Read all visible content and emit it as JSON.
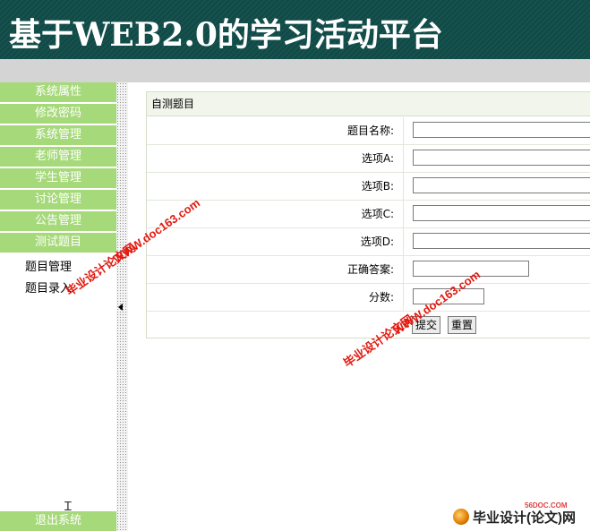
{
  "header": {
    "title": "基于WEB2.0的学习活动平台"
  },
  "sidebar": {
    "items": [
      {
        "label": "系统属性"
      },
      {
        "label": "修改密码"
      },
      {
        "label": "系统管理"
      },
      {
        "label": "老师管理"
      },
      {
        "label": "学生管理"
      },
      {
        "label": "讨论管理"
      },
      {
        "label": "公告管理"
      },
      {
        "label": "测试题目"
      }
    ],
    "sub_items": [
      {
        "label": "题目管理"
      },
      {
        "label": "题目录入"
      }
    ],
    "logout": "退出系统"
  },
  "form": {
    "title": "自测题目",
    "fields": [
      {
        "label": "题目名称:",
        "value": ""
      },
      {
        "label": "选项A:",
        "value": ""
      },
      {
        "label": "选项B:",
        "value": ""
      },
      {
        "label": "选项C:",
        "value": ""
      },
      {
        "label": "选项D:",
        "value": ""
      },
      {
        "label": "正确答案:",
        "value": ""
      },
      {
        "label": "分数:",
        "value": ""
      }
    ],
    "submit_label": "提交",
    "reset_label": "重置"
  },
  "watermarks": {
    "site": "WWW.doc163.com",
    "cn": "毕业设计论文网"
  },
  "footer_logo": {
    "text": "毕业设计(论文)网",
    "small": "56DOC.COM"
  },
  "colors": {
    "header_bg": "#0f4a47",
    "menu_green": "#a6d97a",
    "watermark_red": "#e21a10"
  }
}
